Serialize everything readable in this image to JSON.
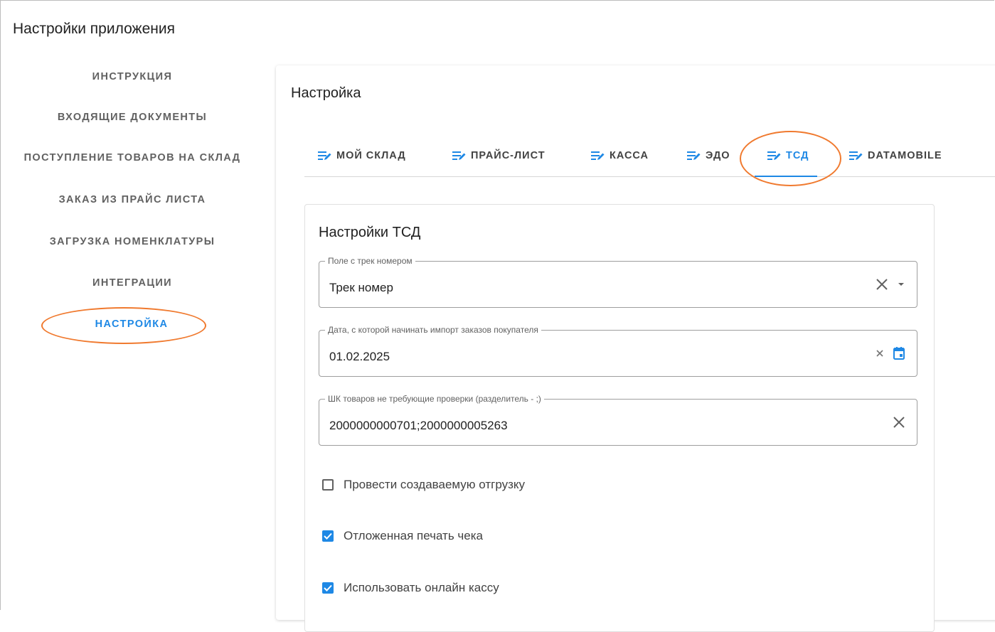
{
  "app": {
    "title": "Настройки приложения"
  },
  "sidebar": {
    "items": [
      {
        "label": "ИНСТРУКЦИЯ",
        "active": false
      },
      {
        "label": "ВХОДЯЩИЕ ДОКУМЕНТЫ",
        "active": false
      },
      {
        "label": "ПОСТУПЛЕНИЕ ТОВАРОВ НА СКЛАД",
        "active": false
      },
      {
        "label": "ЗАКАЗ ИЗ ПРАЙС ЛИСТА",
        "active": false
      },
      {
        "label": "ЗАГРУЗКА НОМЕНКЛАТУРЫ",
        "active": false
      },
      {
        "label": "ИНТЕГРАЦИИ",
        "active": false
      },
      {
        "label": "НАСТРОЙКА",
        "active": true
      }
    ]
  },
  "main": {
    "title": "Настройка",
    "tabs": [
      {
        "label": "МОЙ СКЛАД",
        "icon": "edit-list-icon",
        "active": false
      },
      {
        "label": "ПРАЙС-ЛИСТ",
        "icon": "edit-list-icon",
        "active": false
      },
      {
        "label": "КАССА",
        "icon": "edit-list-icon",
        "active": false
      },
      {
        "label": "ЭДО",
        "icon": "edit-list-icon",
        "active": false
      },
      {
        "label": "ТСД",
        "icon": "edit-list-icon",
        "active": true
      },
      {
        "label": "DATAMOBILE",
        "icon": "edit-list-icon",
        "active": false
      }
    ],
    "tsd": {
      "title": "Настройки ТСД",
      "track_field": {
        "label": "Поле с трек номером",
        "value": "Трек номер"
      },
      "date_field": {
        "label": "Дата, с которой начинать импорт заказов покупателя",
        "value": "01.02.2025"
      },
      "barcodes_field": {
        "label": "ШК товаров не требующие проверки (разделитель - ;)",
        "value": "2000000000701;2000000005263"
      },
      "checkboxes": [
        {
          "label": "Провести создаваемую отгрузку",
          "checked": false
        },
        {
          "label": "Отложенная печать чека",
          "checked": true
        },
        {
          "label": "Использовать онлайн кассу",
          "checked": true
        }
      ]
    }
  },
  "colors": {
    "accent": "#1e88e5",
    "annotation": "#f07a2f"
  }
}
